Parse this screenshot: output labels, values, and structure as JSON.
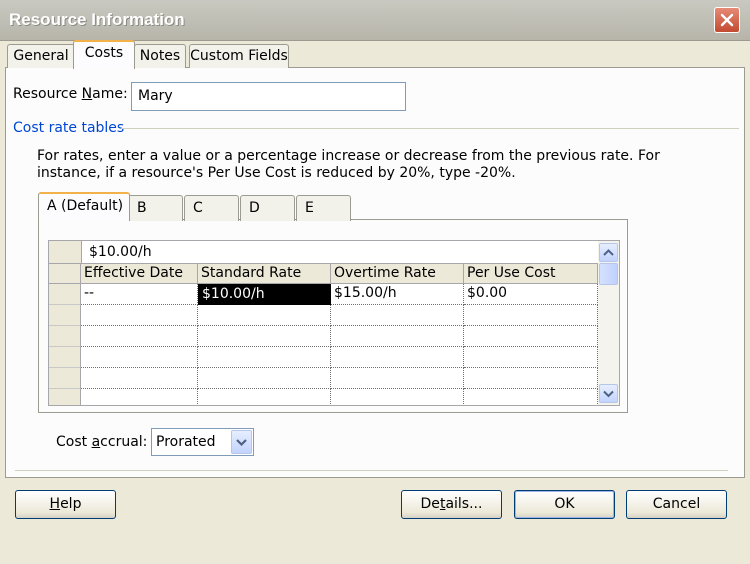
{
  "window": {
    "title": "Resource Information"
  },
  "tabs": [
    {
      "label": "General",
      "active": false
    },
    {
      "label": "Costs",
      "active": true
    },
    {
      "label": "Notes",
      "active": false
    },
    {
      "label": "Custom Fields",
      "active": false
    }
  ],
  "resource_name": {
    "label_pre": "Resource ",
    "label_key": "N",
    "label_post": "ame:",
    "value": "Mary"
  },
  "cost_rate_tables": {
    "group_title": "Cost rate tables",
    "instruction_line1": "For rates, enter a value or a percentage increase or decrease from the previous rate. For",
    "instruction_line2": "instance, if a resource's Per Use Cost is reduced by 20%, type -20%.",
    "tabs": [
      "A (Default)",
      "B",
      "C",
      "D",
      "E"
    ],
    "edit_value": "$10.00/h",
    "columns": [
      "Effective Date",
      "Standard Rate",
      "Overtime Rate",
      "Per Use Cost"
    ],
    "rows": [
      [
        "--",
        "$10.00/h",
        "$15.00/h",
        "$0.00"
      ],
      [
        "",
        "",
        "",
        ""
      ],
      [
        "",
        "",
        "",
        ""
      ],
      [
        "",
        "",
        "",
        ""
      ],
      [
        "",
        "",
        "",
        ""
      ],
      [
        "",
        "",
        "",
        ""
      ]
    ]
  },
  "cost_accrual": {
    "label_pre": "Cost ",
    "label_key": "a",
    "label_post": "ccrual:",
    "value": "Prorated"
  },
  "buttons": {
    "help": {
      "key": "H",
      "rest": "elp"
    },
    "details": {
      "pre": "De",
      "key": "t",
      "post": "ails..."
    },
    "ok": "OK",
    "cancel": "Cancel"
  },
  "icons": {
    "close": "close-icon",
    "scroll_up": "chevron-up-icon",
    "scroll_down": "chevron-down-icon",
    "combo": "chevron-down-icon"
  }
}
